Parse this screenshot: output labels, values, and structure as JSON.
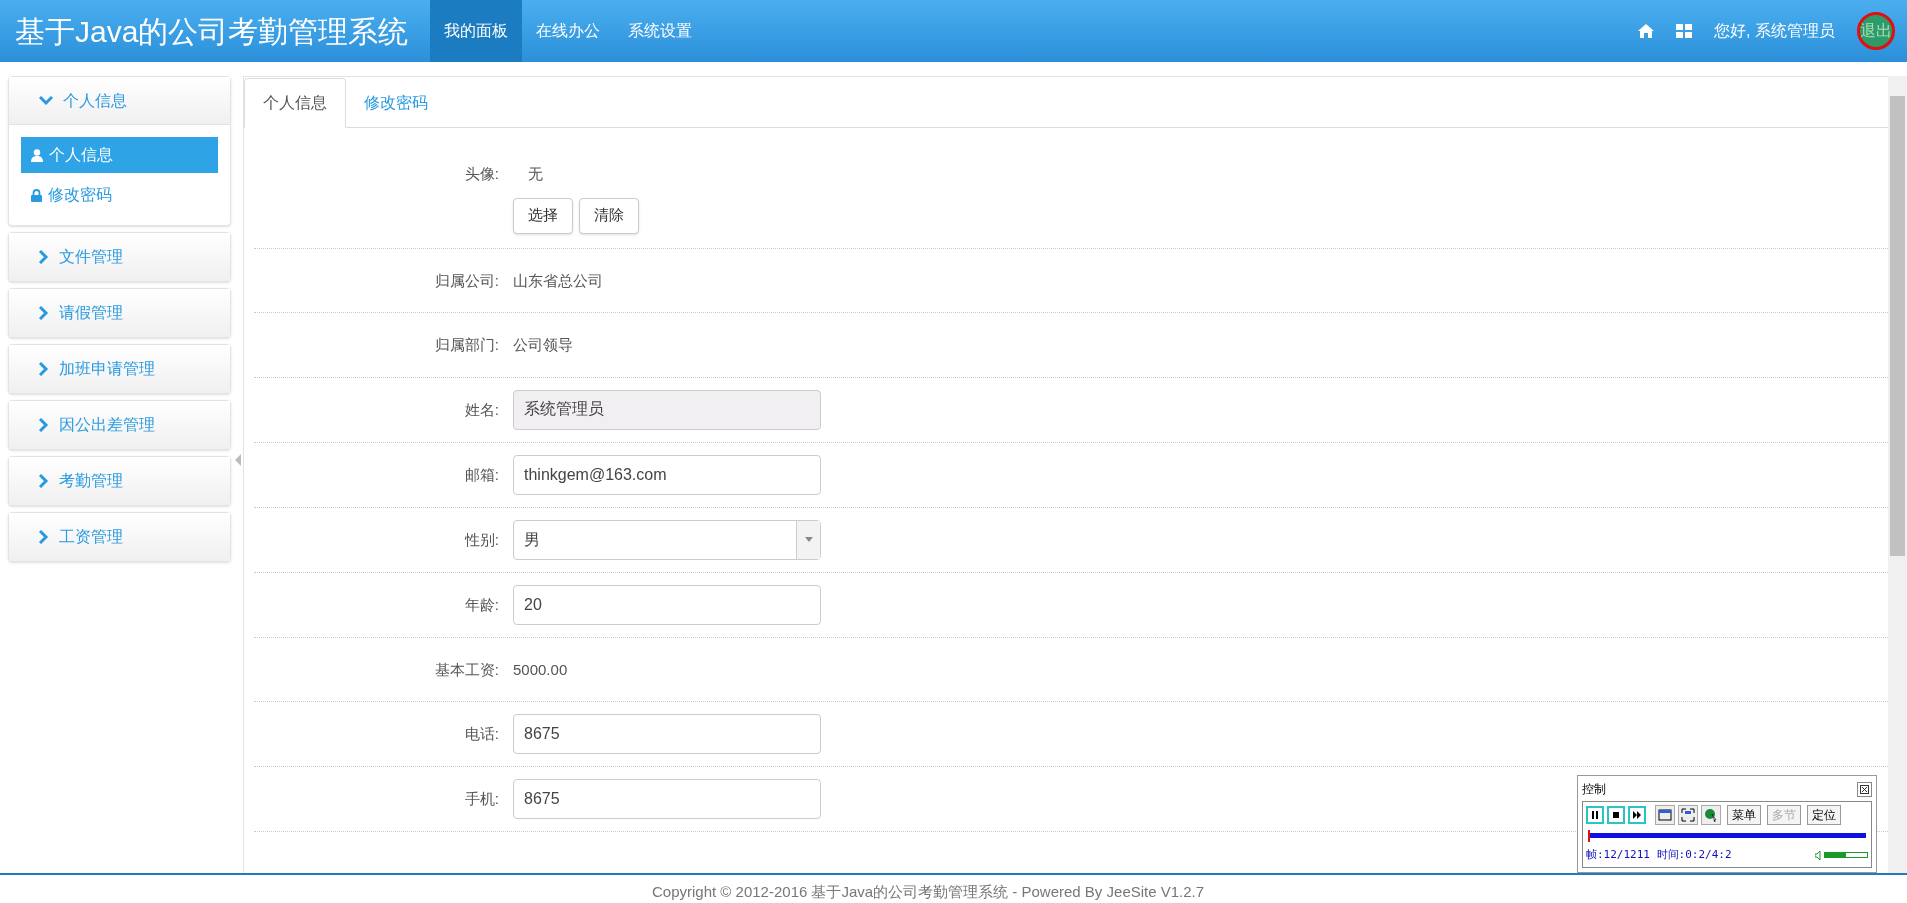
{
  "header": {
    "title": "基于Java的公司考勤管理系统",
    "nav": [
      {
        "label": "我的面板",
        "selected": true
      },
      {
        "label": "在线办公",
        "selected": false
      },
      {
        "label": "系统设置",
        "selected": false
      }
    ],
    "greeting": "您好, 系统管理员",
    "logout": "退出"
  },
  "sidebar": [
    {
      "label": "个人信息",
      "expanded": true,
      "items": [
        {
          "label": "个人信息",
          "selected": true
        },
        {
          "label": "修改密码",
          "selected": false
        }
      ]
    },
    {
      "label": "文件管理",
      "expanded": false
    },
    {
      "label": "请假管理",
      "expanded": false
    },
    {
      "label": "加班申请管理",
      "expanded": false
    },
    {
      "label": "因公出差管理",
      "expanded": false
    },
    {
      "label": "考勤管理",
      "expanded": false
    },
    {
      "label": "工资管理",
      "expanded": false
    }
  ],
  "tabs": [
    {
      "label": "个人信息",
      "selected": true
    },
    {
      "label": "修改密码",
      "selected": false
    }
  ],
  "form": [
    {
      "kind": "avatar",
      "label": "头像:",
      "value": "无",
      "buttons": [
        "选择",
        "清除"
      ]
    },
    {
      "kind": "text",
      "label": "归属公司:",
      "value": "山东省总公司"
    },
    {
      "kind": "text",
      "label": "归属部门:",
      "value": "公司领导"
    },
    {
      "kind": "input",
      "label": "姓名:",
      "value": "系统管理员",
      "disabled": true
    },
    {
      "kind": "input",
      "label": "邮箱:",
      "value": "thinkgem@163.com",
      "disabled": false
    },
    {
      "kind": "select",
      "label": "性别:",
      "value": "男"
    },
    {
      "kind": "input",
      "label": "年龄:",
      "value": "20",
      "disabled": false
    },
    {
      "kind": "text",
      "label": "基本工资:",
      "value": "5000.00"
    },
    {
      "kind": "input",
      "label": "电话:",
      "value": "8675",
      "disabled": false
    },
    {
      "kind": "input",
      "label": "手机:",
      "value": "8675",
      "disabled": false
    }
  ],
  "footer": "Copyright © 2012-2016 基于Java的公司考勤管理系统 - Powered By JeeSite V1.2.7",
  "recorder": {
    "title": "控制",
    "buttons": [
      {
        "label": "菜单",
        "disabled": false
      },
      {
        "label": "多节",
        "disabled": true
      },
      {
        "label": "定位",
        "disabled": false
      }
    ],
    "progress": {
      "level": 0.0
    },
    "status": "帧:12/1211 时间:0:2/4:2",
    "volume": {
      "level": 0.5
    }
  }
}
